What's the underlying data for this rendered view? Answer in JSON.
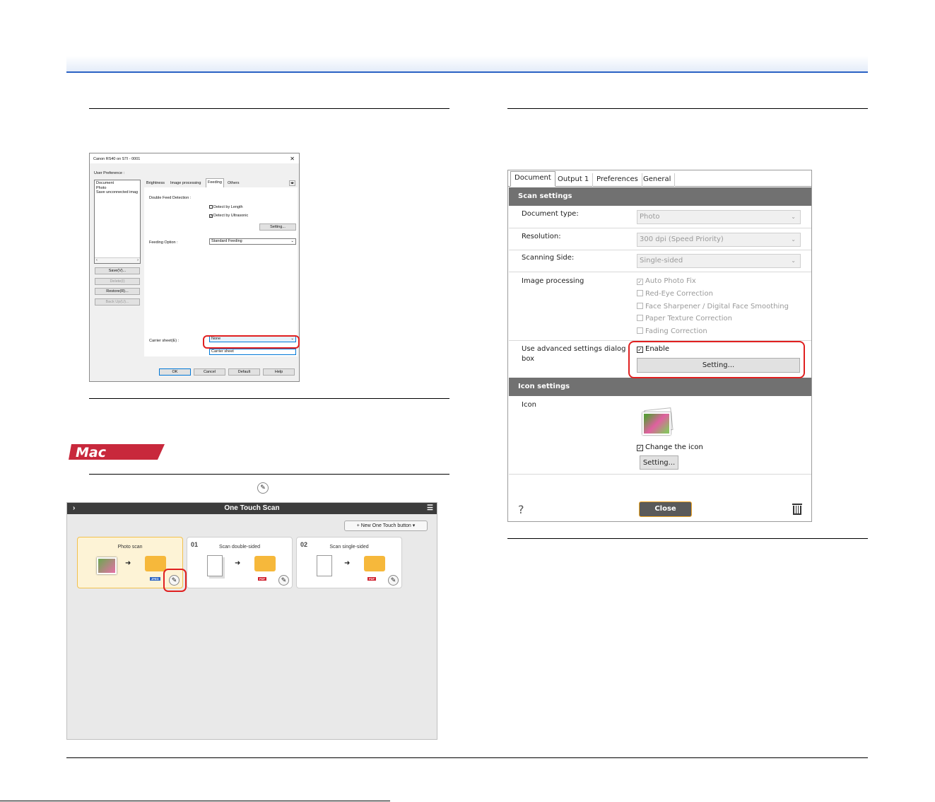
{
  "windows_dialog": {
    "title": "Canon RS40 on STI - 0001",
    "close": "✕",
    "user_preference_label": "User Preference :",
    "preferences": [
      "Document",
      "Photo",
      "Save unconnected imag"
    ],
    "buttons": [
      "Save(V)...",
      "Delete(I)",
      "Restore(R)...",
      "Back Up(U)..."
    ],
    "tabs": [
      "Brightness",
      "Image processing",
      "Feeding",
      "Others"
    ],
    "double_feed_label": "Double Feed Detection :",
    "detect_length": "Detect by Length",
    "detect_ultrasonic": "Detect by Ultrasonic",
    "setting_btn": "Setting...",
    "feeding_option_label": "Feeding Option :",
    "feeding_option_value": "Standard Feeding",
    "carrier_sheet_label": "Carrier sheet(E) :",
    "carrier_sheet_value": "None",
    "carrier_sheet_input": "Carrier sheet",
    "footer_buttons": [
      "OK",
      "Cancel",
      "Default",
      "Help"
    ]
  },
  "mac_badge": "Mac",
  "ots": {
    "title": "One Touch Scan",
    "new_button": "New One Touch button",
    "cards": [
      {
        "num": "",
        "name": "Photo scan",
        "format": "JPEG"
      },
      {
        "num": "01",
        "name": "Scan double-sided",
        "format": "PDF"
      },
      {
        "num": "02",
        "name": "Scan single-sided",
        "format": "PDF"
      }
    ]
  },
  "settings": {
    "tabs": [
      "Document",
      "Output 1",
      "Preferences",
      "General"
    ],
    "scan_settings": "Scan settings",
    "document_type_label": "Document type:",
    "document_type_value": "Photo",
    "resolution_label": "Resolution:",
    "resolution_value": "300 dpi (Speed Priority)",
    "scanning_side_label": "Scanning Side:",
    "scanning_side_value": "Single-sided",
    "image_processing_label": "Image processing",
    "image_options": [
      "Auto Photo Fix",
      "Red-Eye Correction",
      "Face Sharpener / Digital Face Smoothing",
      "Paper Texture Correction",
      "Fading Correction"
    ],
    "advanced_label_1": "Use advanced settings dialog",
    "advanced_label_2": "box",
    "enable": "Enable",
    "setting_btn": "Setting...",
    "icon_settings": "Icon settings",
    "icon_label": "Icon",
    "change_icon": "Change the icon",
    "icon_setting_btn": "Setting...",
    "help": "?",
    "close": "Close"
  },
  "colors": {
    "accent_blue": "#2b63c4",
    "highlight_red": "#e02020",
    "mac_red": "#c8283c",
    "close_border": "#f1a626"
  }
}
